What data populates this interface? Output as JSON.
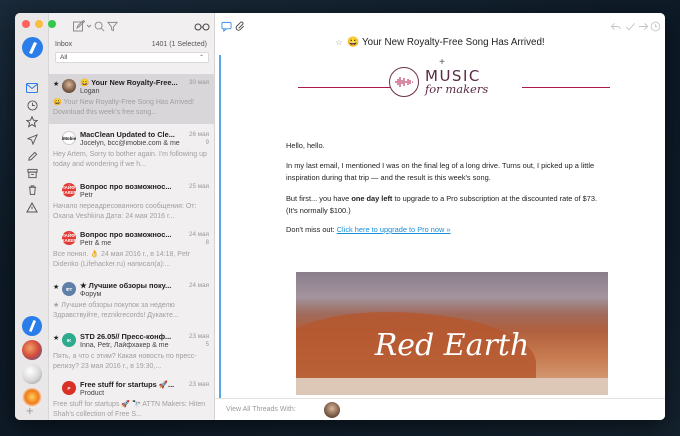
{
  "colors": {
    "accent": "#2b7de9",
    "brand": "#b1174f",
    "link": "#1a8fd8"
  },
  "rail": {
    "icons": [
      "inbox-icon",
      "clock-icon",
      "star-icon",
      "send-icon",
      "pencil-icon",
      "archive-icon",
      "trash-icon",
      "warning-icon"
    ],
    "add_label": "+"
  },
  "list": {
    "mailbox_name": "Inbox",
    "count_text": "1401 (1 Selected)",
    "filter_value": "All",
    "messages": [
      {
        "starred": true,
        "avatar_text": "",
        "avatar_color": "#7c6152",
        "subject": "😀 Your New Royalty-Free...",
        "date": "30 мая",
        "from": "Logan",
        "count": "",
        "preview": "😀 Your New Royalty-Free Song Has Arrived! Download this week's free song...",
        "selected": true
      },
      {
        "starred": false,
        "avatar_text": "iMobie",
        "avatar_color": "#ffffff",
        "subject": "MacClean Updated to Cle...",
        "date": "26 мая",
        "from": "Jocelyn, bcc@imobie.com & me",
        "count": "9",
        "preview": "Hey Artem, Sorry to bother again. I'm following up today and wondering if we h..."
      },
      {
        "starred": false,
        "avatar_text": "ЛАЙФ ХАКЕР",
        "avatar_color": "#e53935",
        "subject": "Вопрос про возможнос...",
        "date": "25 мая",
        "from": "Petr",
        "count": "",
        "preview": "Начало переадресованного сообщения: От: Oxana Veshkina Дата: 24 мая 2016 г..."
      },
      {
        "starred": false,
        "avatar_text": "ЛАЙФ ХАКЕР",
        "avatar_color": "#e53935",
        "subject": "Вопрос про возможнос...",
        "date": "24 мая",
        "from": "Petr & me",
        "count": "8",
        "preview": "Все понял. 👌 24 мая 2016 г., в 14:18, Petr Didenko (Lifehacker.ru) написал(а):..."
      },
      {
        "starred": true,
        "avatar_text": "ФТ",
        "avatar_color": "#5d7fa8",
        "subject": "★ Лучшие обзоры поку...",
        "date": "24 мая",
        "from": "Форум",
        "count": "",
        "preview": "★ Лучшие обзоры покупок за неделю Здравствуйте, reznikrecords! Дукакте..."
      },
      {
        "starred": true,
        "avatar_text": "IK",
        "avatar_color": "#2eaa8c",
        "subject": "STD 26.05// Пресс-конф...",
        "date": "23 мая",
        "from": "Inna, Petr, Лайфхакер & me",
        "count": "5",
        "preview": "Пять, а что с этим? Какая новость по пресс-релизу? 23 мая 2016 г., в 19:30,..."
      },
      {
        "starred": false,
        "avatar_text": "P",
        "avatar_color": "#d93025",
        "subject": "Free stuff for startups 🚀...",
        "date": "23 мая",
        "from": "Product",
        "count": "",
        "preview": "Free stuff for startups 🚀 🔭 ATTN Makers: Hiten Shah's collection of Free S..."
      }
    ]
  },
  "pane": {
    "subject": "😀 Your New Royalty-Free Song Has Arrived!",
    "plus": "+",
    "logo_line1": "MUSIC",
    "logo_line2": "for makers",
    "greeting": "Hello, hello.",
    "para1": "In my last email, I mentioned I was on the final leg of a long drive. Turns out, I picked up a little inspiration during that trip — and the result is this week's song.",
    "para2_before": "But first... you have ",
    "para2_bold": "one day left",
    "para2_after": " to upgrade to a Pro subscription at the discounted rate of $73. (It's normally $100.)",
    "para3_before": "Don't miss out: ",
    "para3_link": "Click here to upgrade to Pro now »",
    "hero_title": "Red Earth",
    "footer_text": "View All Threads With:"
  }
}
